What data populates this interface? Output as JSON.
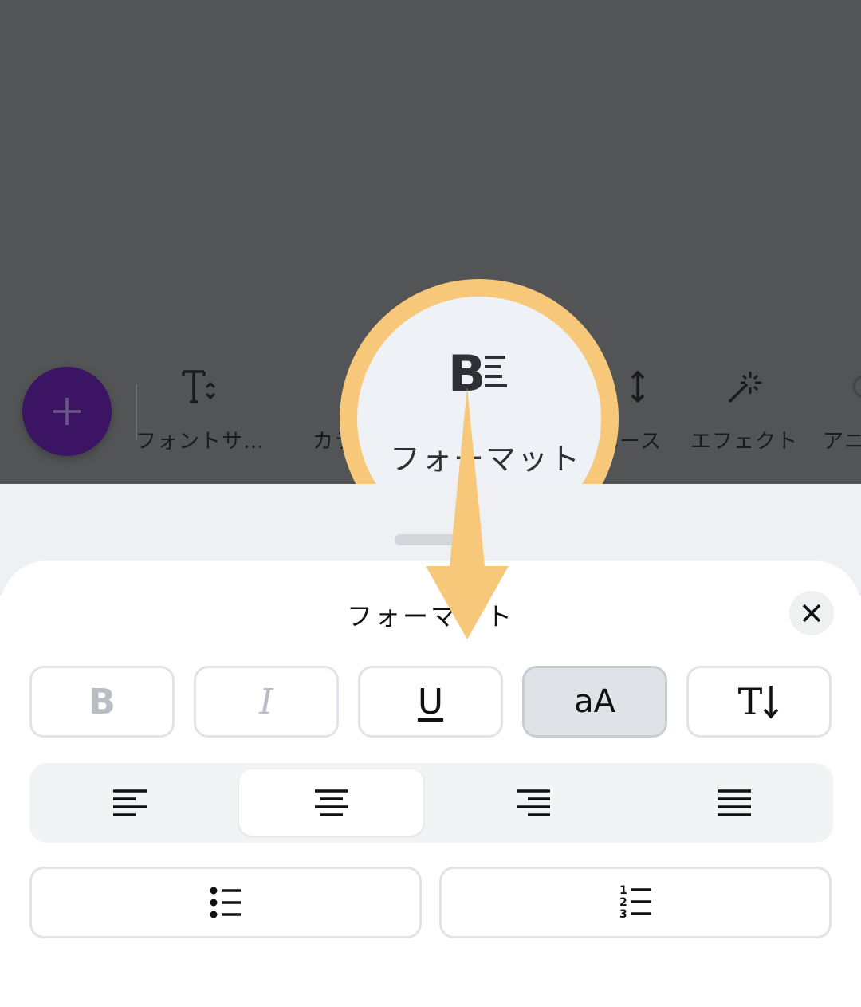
{
  "toolbar": {
    "add_label": "+",
    "items": [
      {
        "label": "フォントサ…",
        "icon": "font-size-icon"
      },
      {
        "label": "カラー",
        "icon": "text-color-icon"
      },
      {
        "label": "フォーマット",
        "icon": "format-icon"
      },
      {
        "label": "スペース",
        "icon": "spacing-icon"
      },
      {
        "label": "エフェクト",
        "icon": "effects-icon"
      },
      {
        "label": "アニメート",
        "icon": "animate-icon"
      }
    ]
  },
  "highlight": {
    "label": "フォーマット",
    "color": "#f8c87a"
  },
  "sheet": {
    "title": "フォーマット",
    "style_buttons": [
      {
        "label": "B",
        "name": "bold"
      },
      {
        "label": "I",
        "name": "italic"
      },
      {
        "label": "U",
        "name": "underline"
      },
      {
        "label": "aA",
        "name": "letter-case",
        "active": true
      },
      {
        "label": "T",
        "name": "text-direction"
      }
    ],
    "alignment": {
      "options": [
        "left",
        "center",
        "right",
        "justify"
      ],
      "selected": "center"
    },
    "lists": [
      "bullet-list",
      "numbered-list"
    ],
    "numbered_digits": [
      "1",
      "2",
      "3"
    ]
  },
  "colors": {
    "accent": "#3c1464",
    "overlay": "#535456",
    "highlight_ring": "#f8c87a"
  }
}
